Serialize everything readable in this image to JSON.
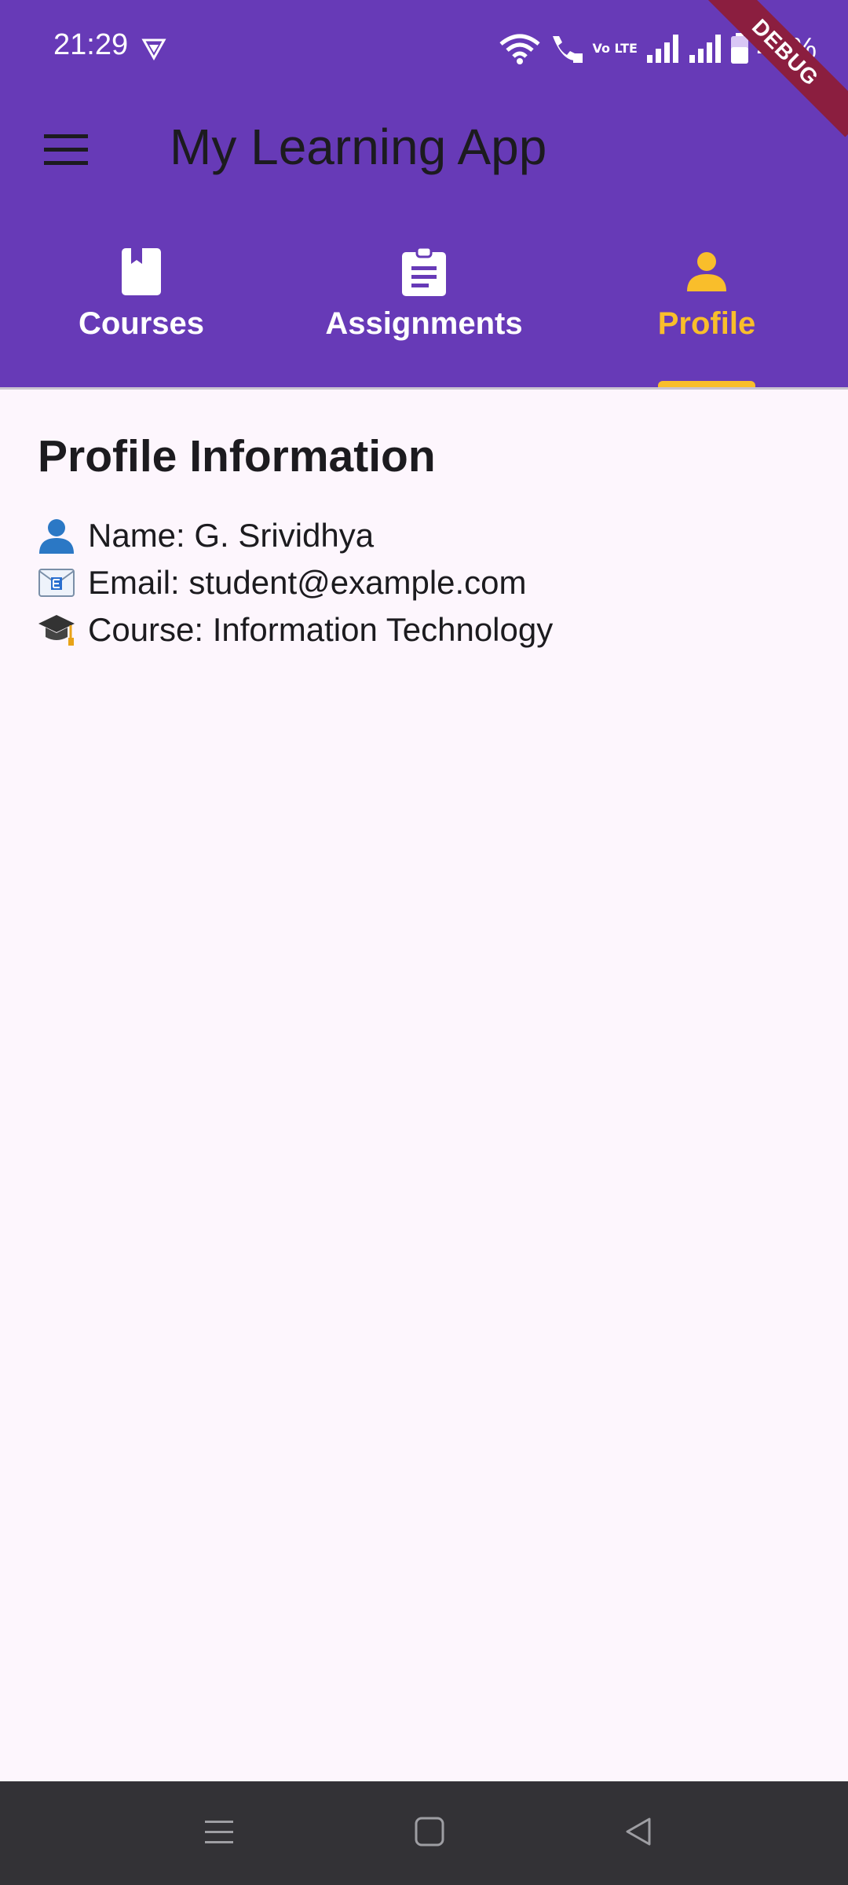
{
  "status_bar": {
    "time": "21:29",
    "battery_percent": "43%",
    "network_label": "Vo LTE"
  },
  "debug_banner": "DEBUG",
  "app_bar": {
    "title": "My Learning App",
    "menu_icon": "hamburger-menu-icon"
  },
  "tabs": [
    {
      "label": "Courses",
      "icon": "book-icon",
      "selected": false
    },
    {
      "label": "Assignments",
      "icon": "clipboard-icon",
      "selected": false
    },
    {
      "label": "Profile",
      "icon": "person-icon",
      "selected": true
    }
  ],
  "profile": {
    "heading": "Profile Information",
    "items": [
      {
        "icon": "person-emoji-icon",
        "text": "Name: G. Srividhya"
      },
      {
        "icon": "email-emoji-icon",
        "text": "Email: student@example.com"
      },
      {
        "icon": "graduation-cap-emoji-icon",
        "text": "Course: Information Technology"
      }
    ]
  },
  "nav_bar": {
    "buttons": [
      "recents-icon",
      "home-icon",
      "back-icon"
    ]
  },
  "colors": {
    "app_bar": "#673ab7",
    "selected_tab": "#f9be2b",
    "background": "#fdf6fd",
    "nav_bar": "#333236"
  }
}
